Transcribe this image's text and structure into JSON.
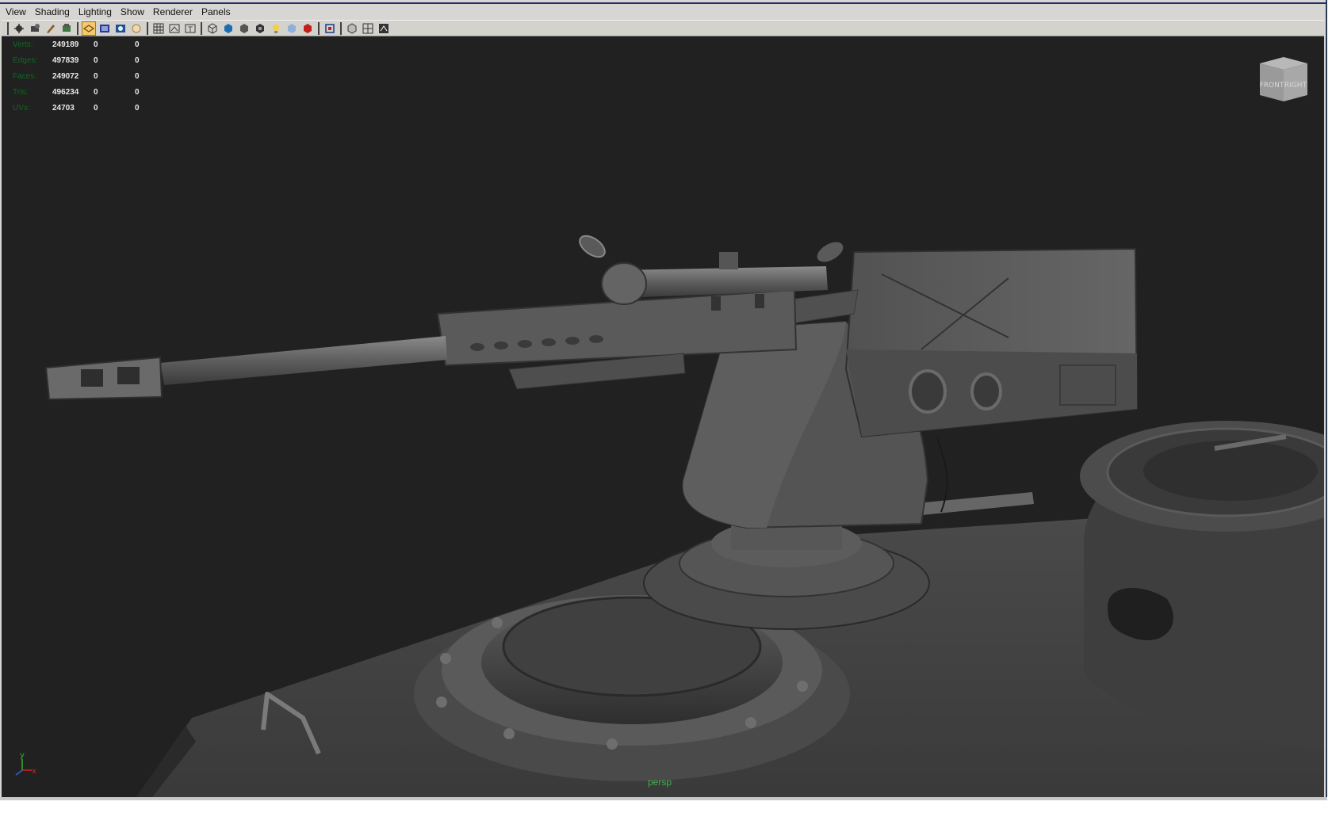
{
  "menubar": {
    "items": [
      "View",
      "Shading",
      "Lighting",
      "Show",
      "Renderer",
      "Panels"
    ]
  },
  "toolbar": {
    "buttons": [
      {
        "name": "select-camera-icon"
      },
      {
        "name": "lock-camera-icon"
      },
      {
        "name": "camera-attributes-icon"
      },
      {
        "name": "bookmarks-icon"
      },
      {
        "name": "image-plane-icon"
      },
      {
        "name": "grid-icon"
      },
      {
        "name": "film-gate-icon"
      },
      {
        "name": "resolution-gate-icon"
      },
      {
        "name": "gate-mask-icon"
      },
      {
        "name": "field-chart-icon"
      },
      {
        "name": "safe-action-icon"
      },
      {
        "name": "safe-title-icon"
      },
      {
        "name": "wireframe-icon"
      },
      {
        "name": "smooth-shade-icon"
      },
      {
        "name": "flat-shade-icon"
      },
      {
        "name": "textured-icon"
      },
      {
        "name": "use-all-lights-icon"
      },
      {
        "name": "shadows-icon"
      },
      {
        "name": "high-quality-icon"
      },
      {
        "name": "isolate-select-icon"
      },
      {
        "name": "xray-icon"
      },
      {
        "name": "xray-joints-icon"
      },
      {
        "name": "xray-components-icon"
      }
    ]
  },
  "hud": {
    "rows": [
      {
        "label": "Verts:",
        "c1": "249189",
        "c2": "0",
        "c3": "0"
      },
      {
        "label": "Edges:",
        "c1": "497839",
        "c2": "0",
        "c3": "0"
      },
      {
        "label": "Faces:",
        "c1": "249072",
        "c2": "0",
        "c3": "0"
      },
      {
        "label": "Tris:",
        "c1": "496234",
        "c2": "0",
        "c3": "0"
      },
      {
        "label": "UVs:",
        "c1": "24703",
        "c2": "0",
        "c3": "0"
      }
    ]
  },
  "viewport": {
    "camera": "persp"
  },
  "viewcube": {
    "front": "FRONT",
    "right": "RIGHT"
  },
  "axis": {
    "y": "y",
    "x": "x"
  },
  "colors": {
    "viewport_bg": "#212121",
    "hud_label": "#0b6b20",
    "hud_value": "#e8e8e8",
    "camera_label": "#3cb04a"
  }
}
